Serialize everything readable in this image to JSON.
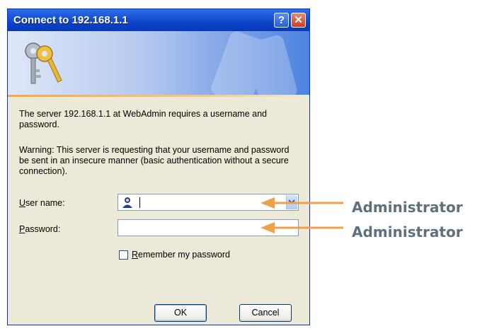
{
  "dialog": {
    "title": "Connect to 192.168.1.1",
    "help_glyph": "?",
    "close_glyph": "✕",
    "message": "The server 192.168.1.1 at WebAdmin requires a username and password.",
    "warning": "Warning: This server is requesting that your username and password be sent in an insecure manner (basic authentication without a secure connection).",
    "username_label_key": "U",
    "username_label_rest": "ser name:",
    "password_label_key": "P",
    "password_label_rest": "assword:",
    "username_value": "",
    "password_value": "",
    "remember_key": "R",
    "remember_rest": "emember my password",
    "remember_checked": false,
    "ok_label": "OK",
    "cancel_label": "Cancel"
  },
  "annotations": {
    "username_hint": "Administrator",
    "password_hint": "Administrator",
    "arrow_color": "#f0a04b"
  },
  "icons": {
    "banner": "keys-icon",
    "user_field": "user-icon",
    "dropdown": "chevron-down-icon"
  }
}
